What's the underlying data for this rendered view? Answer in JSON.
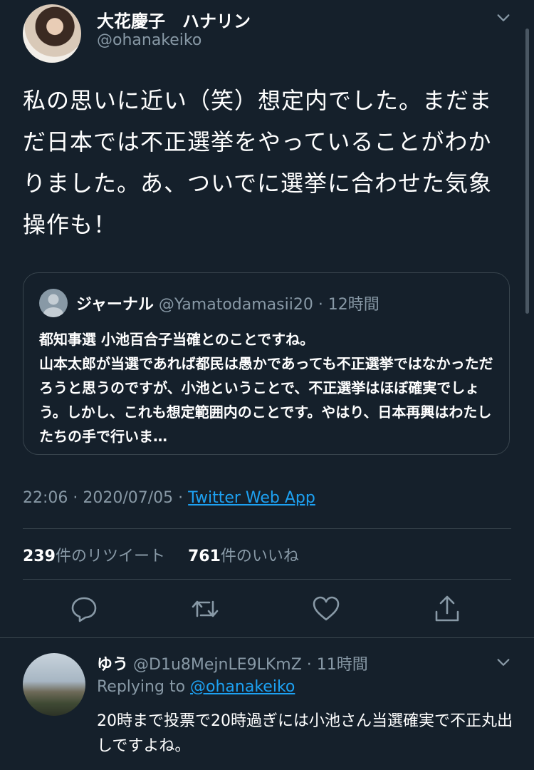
{
  "tweet": {
    "author_name": "大花慶子　ハナリン",
    "author_handle": "@ohanakeiko",
    "text": "私の思いに近い（笑）想定内でした。まだまだ日本では不正選挙をやっていることがわかりました。あ、ついでに選挙に合わせた気象操作も！",
    "timestamp": "22:06 · 2020/07/05 · ",
    "source": "Twitter Web App",
    "retweets_count": "239",
    "retweets_label": "件のリツイート",
    "likes_count": "761",
    "likes_label": "件のいいね"
  },
  "quote": {
    "name": "ジャーナル",
    "handle_time": " @Yamatodamasii20 · 12時間",
    "text": "都知事選 小池百合子当確とのことですね。\n山本太郎が当選であれば都民は愚かであっても不正選挙ではなかっただろうと思うのですが、小池ということで、不正選挙はほぼ確実でしょう。しかし、これも想定範囲内のことです。やはり、日本再興はわたしたちの手で行いま…"
  },
  "reply": {
    "name": "ゆう",
    "handle_time": " @D1u8MejnLE9LKmZ · 11時間",
    "replying_prefix": "Replying to ",
    "replying_handle": "@ohanakeiko",
    "text": "20時まで投票で20時過ぎには小池さん当選確実で不正丸出しですよね。"
  },
  "icons": {
    "main_menu": "chevron-down-icon",
    "reply_menu": "chevron-down-icon",
    "actions": [
      "reply-icon",
      "retweet-icon",
      "like-icon",
      "share-icon"
    ]
  },
  "colors": {
    "background": "#15202b",
    "text_secondary": "#8899a6",
    "link": "#1da1f2",
    "border": "#38444d"
  }
}
